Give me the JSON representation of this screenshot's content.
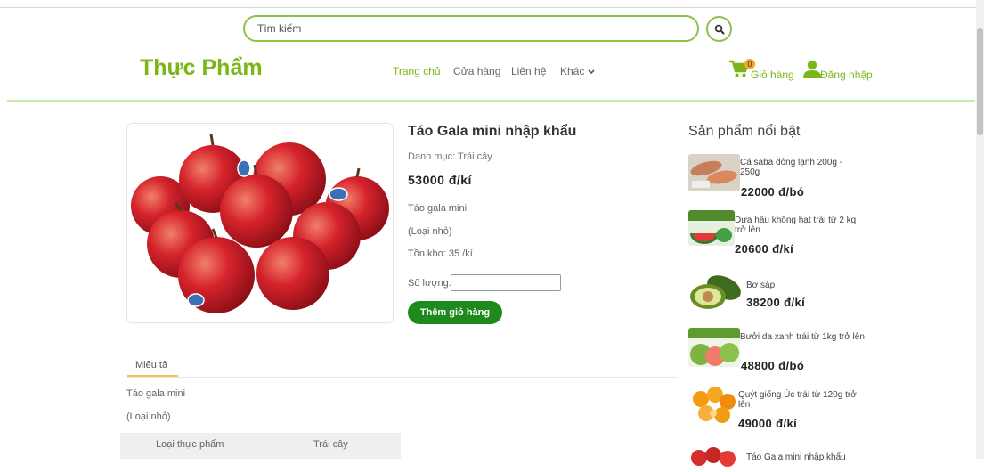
{
  "search": {
    "placeholder": "Tìm kiếm"
  },
  "brand": {
    "logo": "Thực Phẩm"
  },
  "nav": {
    "home": "Trang chủ",
    "shop": "Cửa hàng",
    "contact": "Liên hệ",
    "more": "Khác"
  },
  "header": {
    "cart_count": "0",
    "cart_label": "Giỏ hàng",
    "login_label": "Đăng nhập"
  },
  "product": {
    "title": "Táo Gala mini nhập khẩu",
    "category": "Danh mục: Trái cây",
    "price": "53000 đ/kí",
    "desc_line1": "Táo gala mini",
    "desc_line2": "(Loại nhỏ)",
    "stock": "Tồn kho: 35 /kí",
    "quantity_label": "Số lượng:",
    "quantity_value": "",
    "add_to_cart": "Thêm giỏ hàng"
  },
  "tabs": {
    "description": "Miêu tả"
  },
  "description": {
    "line1": "Táo gala mini",
    "line2": "(Loại nhỏ)"
  },
  "specs": {
    "key": "Loại thực phẩm",
    "value": "Trái cây"
  },
  "featured": {
    "title": "Sản phẩm nổi bật",
    "items": [
      {
        "name": "Cá saba đông lạnh 200g - 250g",
        "price": "22000 đ/bó"
      },
      {
        "name": "Dưa hấu không hạt trái từ 2 kg trở lên",
        "price": "20600 đ/kí"
      },
      {
        "name": "Bơ sáp",
        "price": "38200 đ/kí"
      },
      {
        "name": "Bưởi da xanh trái từ 1kg trở lên",
        "price": "48800 đ/bó"
      },
      {
        "name": "Quýt giống Úc trái từ 120g trở lên",
        "price": "49000 đ/kí"
      },
      {
        "name": "Táo Gala mini nhập khẩu",
        "price": ""
      }
    ]
  },
  "colors": {
    "brand_green": "#7cb518",
    "button_green": "#1e8a1e",
    "badge": "#f5a623"
  }
}
